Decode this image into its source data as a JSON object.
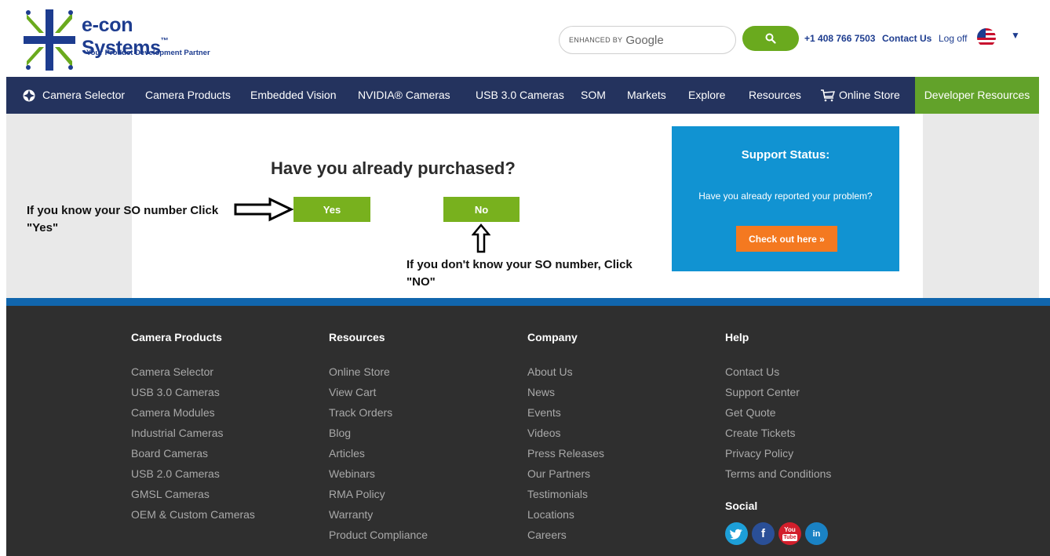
{
  "header": {
    "brand": "e-con Systems",
    "trademark": "™",
    "tagline": "Your Product Development Partner",
    "search": {
      "enhanced_by": "ENHANCED BY",
      "provider": "Google"
    },
    "phone": "+1 408 766 7503",
    "contact": "Contact Us",
    "logoff": "Log off"
  },
  "nav": {
    "items": [
      "Camera Selector",
      "Camera Products",
      "Embedded Vision",
      "NVIDIA® Cameras",
      "USB 3.0 Cameras",
      "SOM",
      "Markets",
      "Explore",
      "Resources",
      "Online Store"
    ],
    "developer": "Developer Resources"
  },
  "main": {
    "question": "Have you already purchased?",
    "yes_label": "Yes",
    "no_label": "No",
    "note_yes_line1": "If you know your SO number Click",
    "note_yes_line2": "\"Yes\"",
    "note_no_line1": "If you don't know your SO number, Click",
    "note_no_line2": "\"NO\""
  },
  "support": {
    "title": "Support Status:",
    "text": "Have you already reported your problem?",
    "button": "Check out here »"
  },
  "footer": {
    "columns": [
      {
        "title": "Camera Products",
        "links": [
          "Camera Selector",
          "USB 3.0 Cameras",
          "Camera Modules",
          "Industrial Cameras",
          "Board Cameras",
          "USB 2.0 Cameras",
          "GMSL Cameras",
          "OEM & Custom Cameras"
        ]
      },
      {
        "title": "Resources",
        "links": [
          "Online Store",
          "View Cart",
          "Track Orders",
          "Blog",
          "Articles",
          "Webinars",
          "RMA Policy",
          "Warranty",
          "Product Compliance"
        ]
      },
      {
        "title": "Company",
        "links": [
          "About Us",
          "News",
          "Events",
          "Videos",
          "Press Releases",
          "Our Partners",
          "Testimonials",
          "Locations",
          "Careers"
        ]
      },
      {
        "title": "Help",
        "links": [
          "Contact Us",
          "Support Center",
          "Get Quote",
          "Create Tickets",
          "Privacy Policy",
          "Terms and Conditions"
        ]
      }
    ],
    "social_title": "Social",
    "social": {
      "facebook": "f",
      "youtube_top": "You",
      "youtube_bottom": "Tube",
      "linkedin": "in"
    }
  },
  "colors": {
    "nav_bg": "#24335e",
    "accent_green": "#78b11e",
    "support_blue": "#1193d2",
    "cta_orange": "#f47920",
    "footer_bg": "#2f2f2f"
  }
}
